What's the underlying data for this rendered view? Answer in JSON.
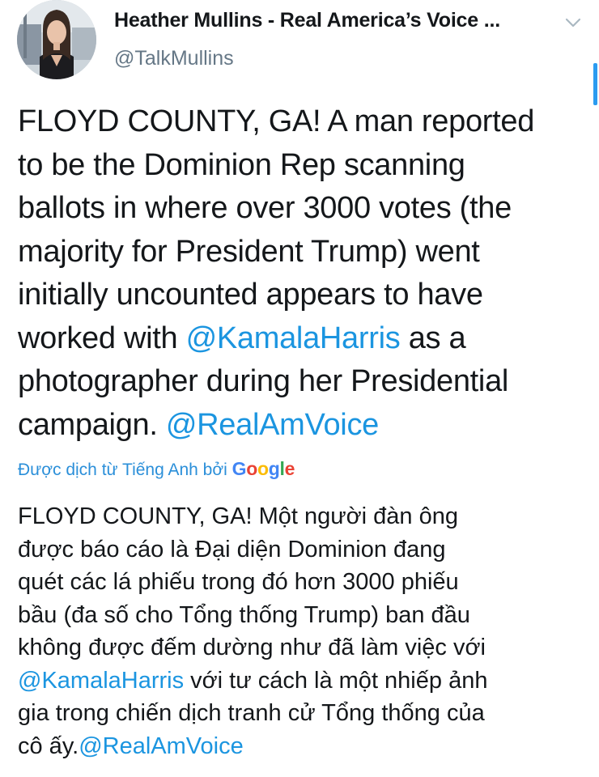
{
  "author": {
    "name": "Heather Mullins - Real America’s Voice ...",
    "handle": "@TalkMullins",
    "avatar_icon": "profile-photo"
  },
  "menu": {
    "icon": "chevron-down-icon"
  },
  "tweet": {
    "lines": [
      {
        "parts": [
          {
            "text": "FLOYD COUNTY, GA! A man reported",
            "mention": false
          }
        ]
      },
      {
        "parts": [
          {
            "text": "to be the Dominion Rep scanning",
            "mention": false
          }
        ]
      },
      {
        "parts": [
          {
            "text": "ballots in where over 3000 votes (the",
            "mention": false
          }
        ]
      },
      {
        "parts": [
          {
            "text": "majority for President Trump) went",
            "mention": false
          }
        ]
      },
      {
        "parts": [
          {
            "text": "initially uncounted appears to have",
            "mention": false
          }
        ]
      },
      {
        "parts": [
          {
            "text": "worked with ",
            "mention": false
          },
          {
            "text": "@KamalaHarris",
            "mention": true
          },
          {
            "text": " as a",
            "mention": false
          }
        ]
      },
      {
        "parts": [
          {
            "text": "photographer during her Presidential",
            "mention": false
          }
        ]
      },
      {
        "parts": [
          {
            "text": "campaign. ",
            "mention": false
          },
          {
            "text": "@RealAmVoice",
            "mention": true
          }
        ]
      }
    ]
  },
  "translation": {
    "label": "Được dịch từ Tiếng Anh bởi",
    "provider": "Google",
    "provider_colors": [
      "#4285f4",
      "#ea4335",
      "#fbbc05",
      "#4285f4",
      "#34a853",
      "#ea4335"
    ],
    "lines": [
      {
        "parts": [
          {
            "text": "FLOYD COUNTY, GA! Một người đàn ông",
            "mention": false
          }
        ]
      },
      {
        "parts": [
          {
            "text": "được báo cáo là Đại diện Dominion đang",
            "mention": false
          }
        ]
      },
      {
        "parts": [
          {
            "text": "quét các lá phiếu trong đó hơn 3000 phiếu",
            "mention": false
          }
        ]
      },
      {
        "parts": [
          {
            "text": "bầu (đa số cho Tổng thống Trump) ban đầu",
            "mention": false
          }
        ]
      },
      {
        "parts": [
          {
            "text": "không được đếm dường như đã làm việc với",
            "mention": false
          }
        ]
      },
      {
        "parts": [
          {
            "text": "@KamalaHarris",
            "mention": true
          },
          {
            "text": " với tư cách là một nhiếp ảnh",
            "mention": false
          }
        ]
      },
      {
        "parts": [
          {
            "text": "gia trong chiến dịch tranh cử Tổng thống của",
            "mention": false
          }
        ]
      },
      {
        "parts": [
          {
            "text": "cô ấy.",
            "mention": false
          },
          {
            "text": "@RealAmVoice",
            "mention": true
          }
        ]
      }
    ]
  },
  "colors": {
    "mention": "#1b95e0",
    "handle": "#657786",
    "translate_link": "#2b8fd9"
  }
}
